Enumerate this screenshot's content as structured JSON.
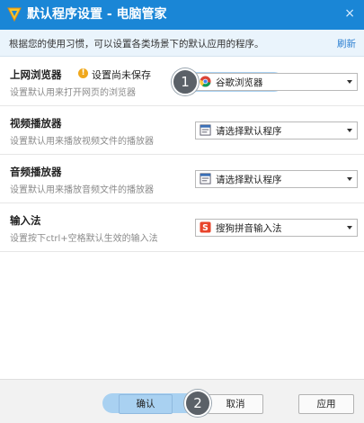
{
  "window": {
    "title": "默认程序设置 - 电脑管家",
    "close_label": "×"
  },
  "info": {
    "description": "根据您的使用习惯，可以设置各类场景下的默认应用的程序。",
    "refresh_label": "刷新"
  },
  "sections": [
    {
      "title": "上网浏览器",
      "subtitle": "设置默认用来打开网页的浏览器",
      "warning": "设置尚未保存",
      "selected": "谷歌浏览器",
      "icon": "chrome-icon"
    },
    {
      "title": "视频播放器",
      "subtitle": "设置默认用来播放视频文件的播放器",
      "selected": "请选择默认程序",
      "icon": "program-icon"
    },
    {
      "title": "音频播放器",
      "subtitle": "设置默认用来播放音频文件的播放器",
      "selected": "请选择默认程序",
      "icon": "program-icon"
    },
    {
      "title": "输入法",
      "subtitle": "设置按下ctrl+空格默认生效的输入法",
      "selected": "搜狗拼音输入法",
      "icon": "sogou-icon"
    }
  ],
  "annotations": {
    "step1": "1",
    "step2": "2"
  },
  "buttons": {
    "ok": "确认",
    "cancel": "取消",
    "apply": "应用"
  },
  "colors": {
    "title_bar": "#1a86d6",
    "accent_link": "#2b7fd1",
    "warning": "#f0a81c"
  }
}
